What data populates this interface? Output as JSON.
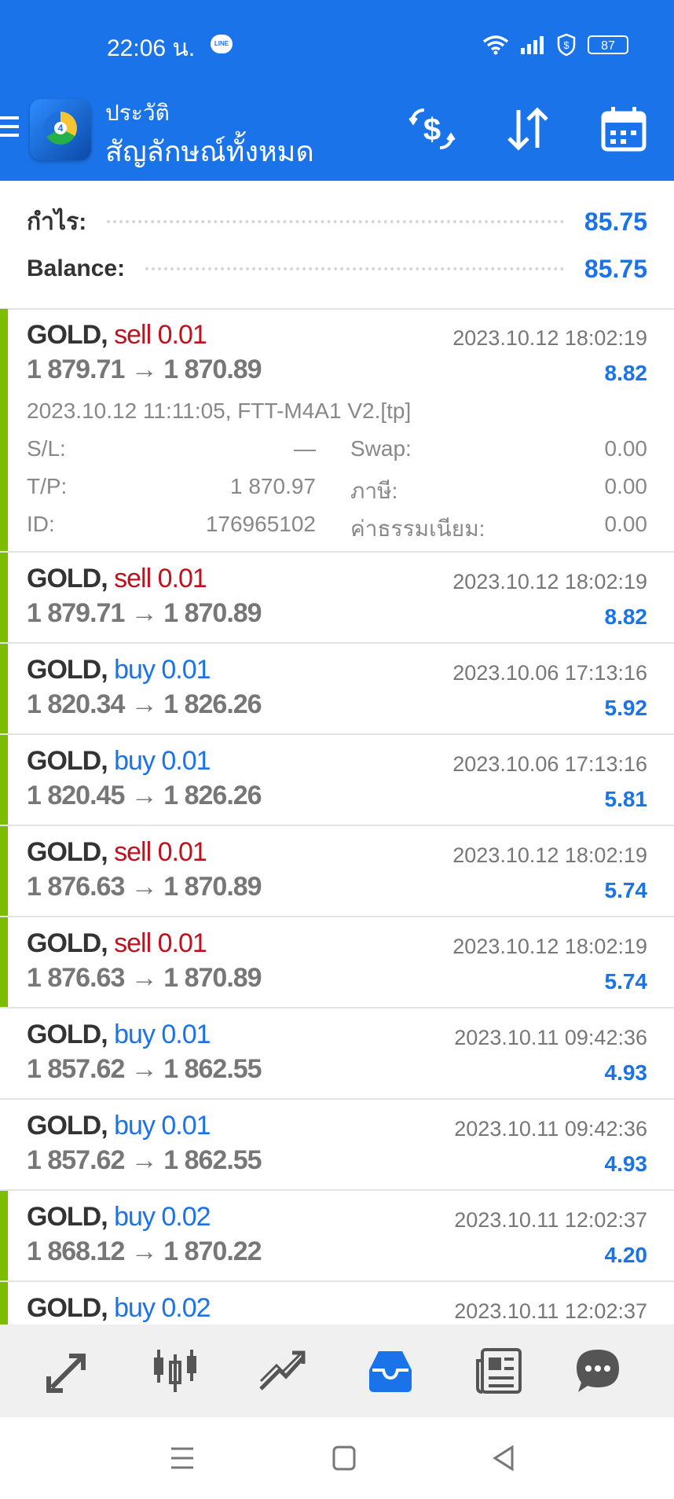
{
  "status_bar": {
    "time": "22:06 น.",
    "line_icon_text": "LINE",
    "battery": "87",
    "icons": [
      "line-icon",
      "wifi-icon",
      "signal-icon",
      "vpn-shield-icon",
      "battery-icon"
    ]
  },
  "toolbar": {
    "title": "ประวัติ",
    "subtitle": "สัญลักษณ์ทั้งหมด",
    "logo_text": "4",
    "icons": [
      "menu-icon",
      "mt4-logo",
      "currency-exchange-icon",
      "sort-icon",
      "calendar-icon"
    ]
  },
  "summary": {
    "profit_label": "กำไร:",
    "profit_value": "85.75",
    "balance_label": "Balance:",
    "balance_value": "85.75"
  },
  "expanded_details": {
    "open_info": "2023.10.12 11:11:05, FTT-M4A1 V2.[tp]",
    "sl_label": "S/L:",
    "sl_value": "—",
    "swap_label": "Swap:",
    "swap_value": "0.00",
    "tp_label": "T/P:",
    "tp_value": "1 870.97",
    "tax_label": "ภาษี:",
    "tax_value": "0.00",
    "id_label": "ID:",
    "id_value": "176965102",
    "commission_label": "ค่าธรรมเนียม:",
    "commission_value": "0.00"
  },
  "trades": [
    {
      "symbol": "GOLD,",
      "type": "sell 0.01",
      "prices": "1 879.71 → 1 870.89",
      "time": "2023.10.12 18:02:19",
      "profit": "8.82"
    },
    {
      "symbol": "GOLD,",
      "type": "sell 0.01",
      "prices": "1 879.71 → 1 870.89",
      "time": "2023.10.12 18:02:19",
      "profit": "8.82"
    },
    {
      "symbol": "GOLD,",
      "type": "buy 0.01",
      "prices": "1 820.34 → 1 826.26",
      "time": "2023.10.06 17:13:16",
      "profit": "5.92"
    },
    {
      "symbol": "GOLD,",
      "type": "buy 0.01",
      "prices": "1 820.45 → 1 826.26",
      "time": "2023.10.06 17:13:16",
      "profit": "5.81"
    },
    {
      "symbol": "GOLD,",
      "type": "sell 0.01",
      "prices": "1 876.63 → 1 870.89",
      "time": "2023.10.12 18:02:19",
      "profit": "5.74"
    },
    {
      "symbol": "GOLD,",
      "type": "sell 0.01",
      "prices": "1 876.63 → 1 870.89",
      "time": "2023.10.12 18:02:19",
      "profit": "5.74"
    },
    {
      "symbol": "GOLD,",
      "type": "buy 0.01",
      "prices": "1 857.62 → 1 862.55",
      "time": "2023.10.11 09:42:36",
      "profit": "4.93"
    },
    {
      "symbol": "GOLD,",
      "type": "buy 0.01",
      "prices": "1 857.62 → 1 862.55",
      "time": "2023.10.11 09:42:36",
      "profit": "4.93"
    },
    {
      "symbol": "GOLD,",
      "type": "buy 0.02",
      "prices": "1 868.12 → 1 870.22",
      "time": "2023.10.11 12:02:37",
      "profit": "4.20"
    },
    {
      "symbol": "GOLD,",
      "type": "buy 0.02",
      "prices": "",
      "time": "2023.10.11 12:02:37",
      "profit": ""
    }
  ],
  "bottom_nav": [
    "quotes-icon",
    "chart-icon",
    "trade-icon",
    "history-icon",
    "news-icon",
    "chat-icon"
  ],
  "system_nav": [
    "recents-icon",
    "home-icon",
    "back-icon"
  ],
  "colors": {
    "primary": "#1a73e8",
    "sell": "#c0111f",
    "buy": "#1a73e8",
    "accent_bar": "#7dbd00",
    "active_tab": "#1a73e8",
    "inactive_tab": "#555555"
  }
}
